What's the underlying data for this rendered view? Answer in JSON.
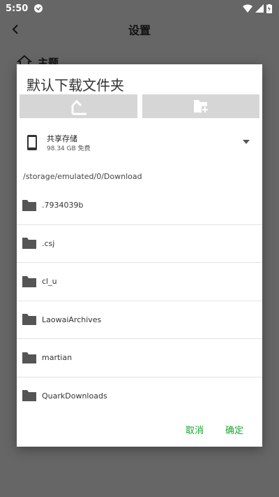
{
  "status_bar": {
    "time": "5:50",
    "wifi_icon": "wifi-icon",
    "signal_icon": "signal-icon",
    "battery_icon": "battery-icon"
  },
  "app_bar": {
    "title": "设置",
    "back_icon": "back-arrow-icon"
  },
  "background_item": {
    "label": "主题",
    "icon": "theme-icon"
  },
  "dialog": {
    "title": "默认下载文件夹",
    "buttons": {
      "up_icon": "up-folder-icon",
      "new_folder_icon": "new-folder-icon"
    },
    "storage": {
      "name": "共享存储",
      "free": "98.34 GB 免费"
    },
    "path": "/storage/emulated/0/Download",
    "folders": [
      {
        "name": ".7934039b"
      },
      {
        "name": ".csj"
      },
      {
        "name": "cl_u"
      },
      {
        "name": "LaowaiArchives"
      },
      {
        "name": "martian"
      },
      {
        "name": "QuarkDownloads"
      }
    ],
    "cancel_label": "取消",
    "ok_label": "确定",
    "accent_color": "#1aa52e"
  }
}
